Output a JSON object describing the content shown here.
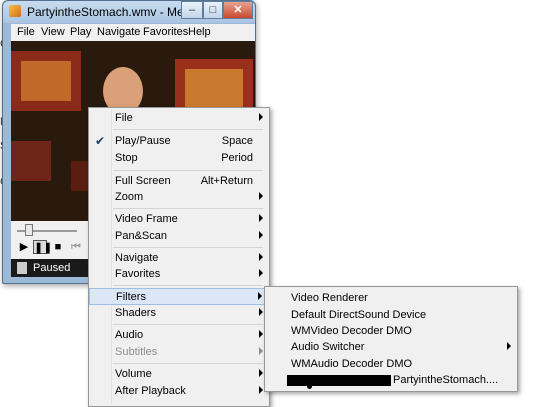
{
  "window": {
    "title": "PartyintheStomach.wmv - Media Pla...",
    "controls": {
      "minimize": "–",
      "maximize": "□",
      "close": "✕"
    },
    "menubar": [
      "File",
      "View",
      "Play",
      "Navigate",
      "Favorites",
      "Help"
    ],
    "status": "Paused"
  },
  "background_fragments": [
    "C",
    "N",
    "S",
    "C"
  ],
  "context_menu": {
    "items": [
      {
        "label": "File",
        "shortcut": "",
        "submenu": true
      },
      {
        "label": "Play/Pause",
        "shortcut": "Space",
        "checked": true
      },
      {
        "label": "Stop",
        "shortcut": "Period"
      },
      {
        "label": "Full Screen",
        "shortcut": "Alt+Return"
      },
      {
        "label": "Zoom",
        "submenu": true
      },
      {
        "label": "Video Frame",
        "submenu": true
      },
      {
        "label": "Pan&Scan",
        "submenu": true
      },
      {
        "label": "Navigate",
        "submenu": true
      },
      {
        "label": "Favorites",
        "submenu": true
      },
      {
        "label": "Filters",
        "submenu": true,
        "highlighted": true
      },
      {
        "label": "Shaders",
        "submenu": true
      },
      {
        "label": "Audio",
        "submenu": true
      },
      {
        "label": "Subtitles",
        "submenu": true,
        "disabled": true
      },
      {
        "label": "Volume",
        "submenu": true
      },
      {
        "label": "After Playback",
        "submenu": true
      }
    ]
  },
  "filters_submenu": {
    "items": [
      {
        "label": "Video Renderer"
      },
      {
        "label": "Default DirectSound Device"
      },
      {
        "label": "WMVideo Decoder DMO"
      },
      {
        "label": "Audio Switcher",
        "submenu": true
      },
      {
        "label": "WMAudio Decoder DMO"
      },
      {
        "label": "PartyintheStomach...."
      }
    ]
  },
  "colors": {
    "menu_bg": "#f0f0f0",
    "highlight": "#dbe7f5",
    "title_bar": "#a9c4e2"
  }
}
